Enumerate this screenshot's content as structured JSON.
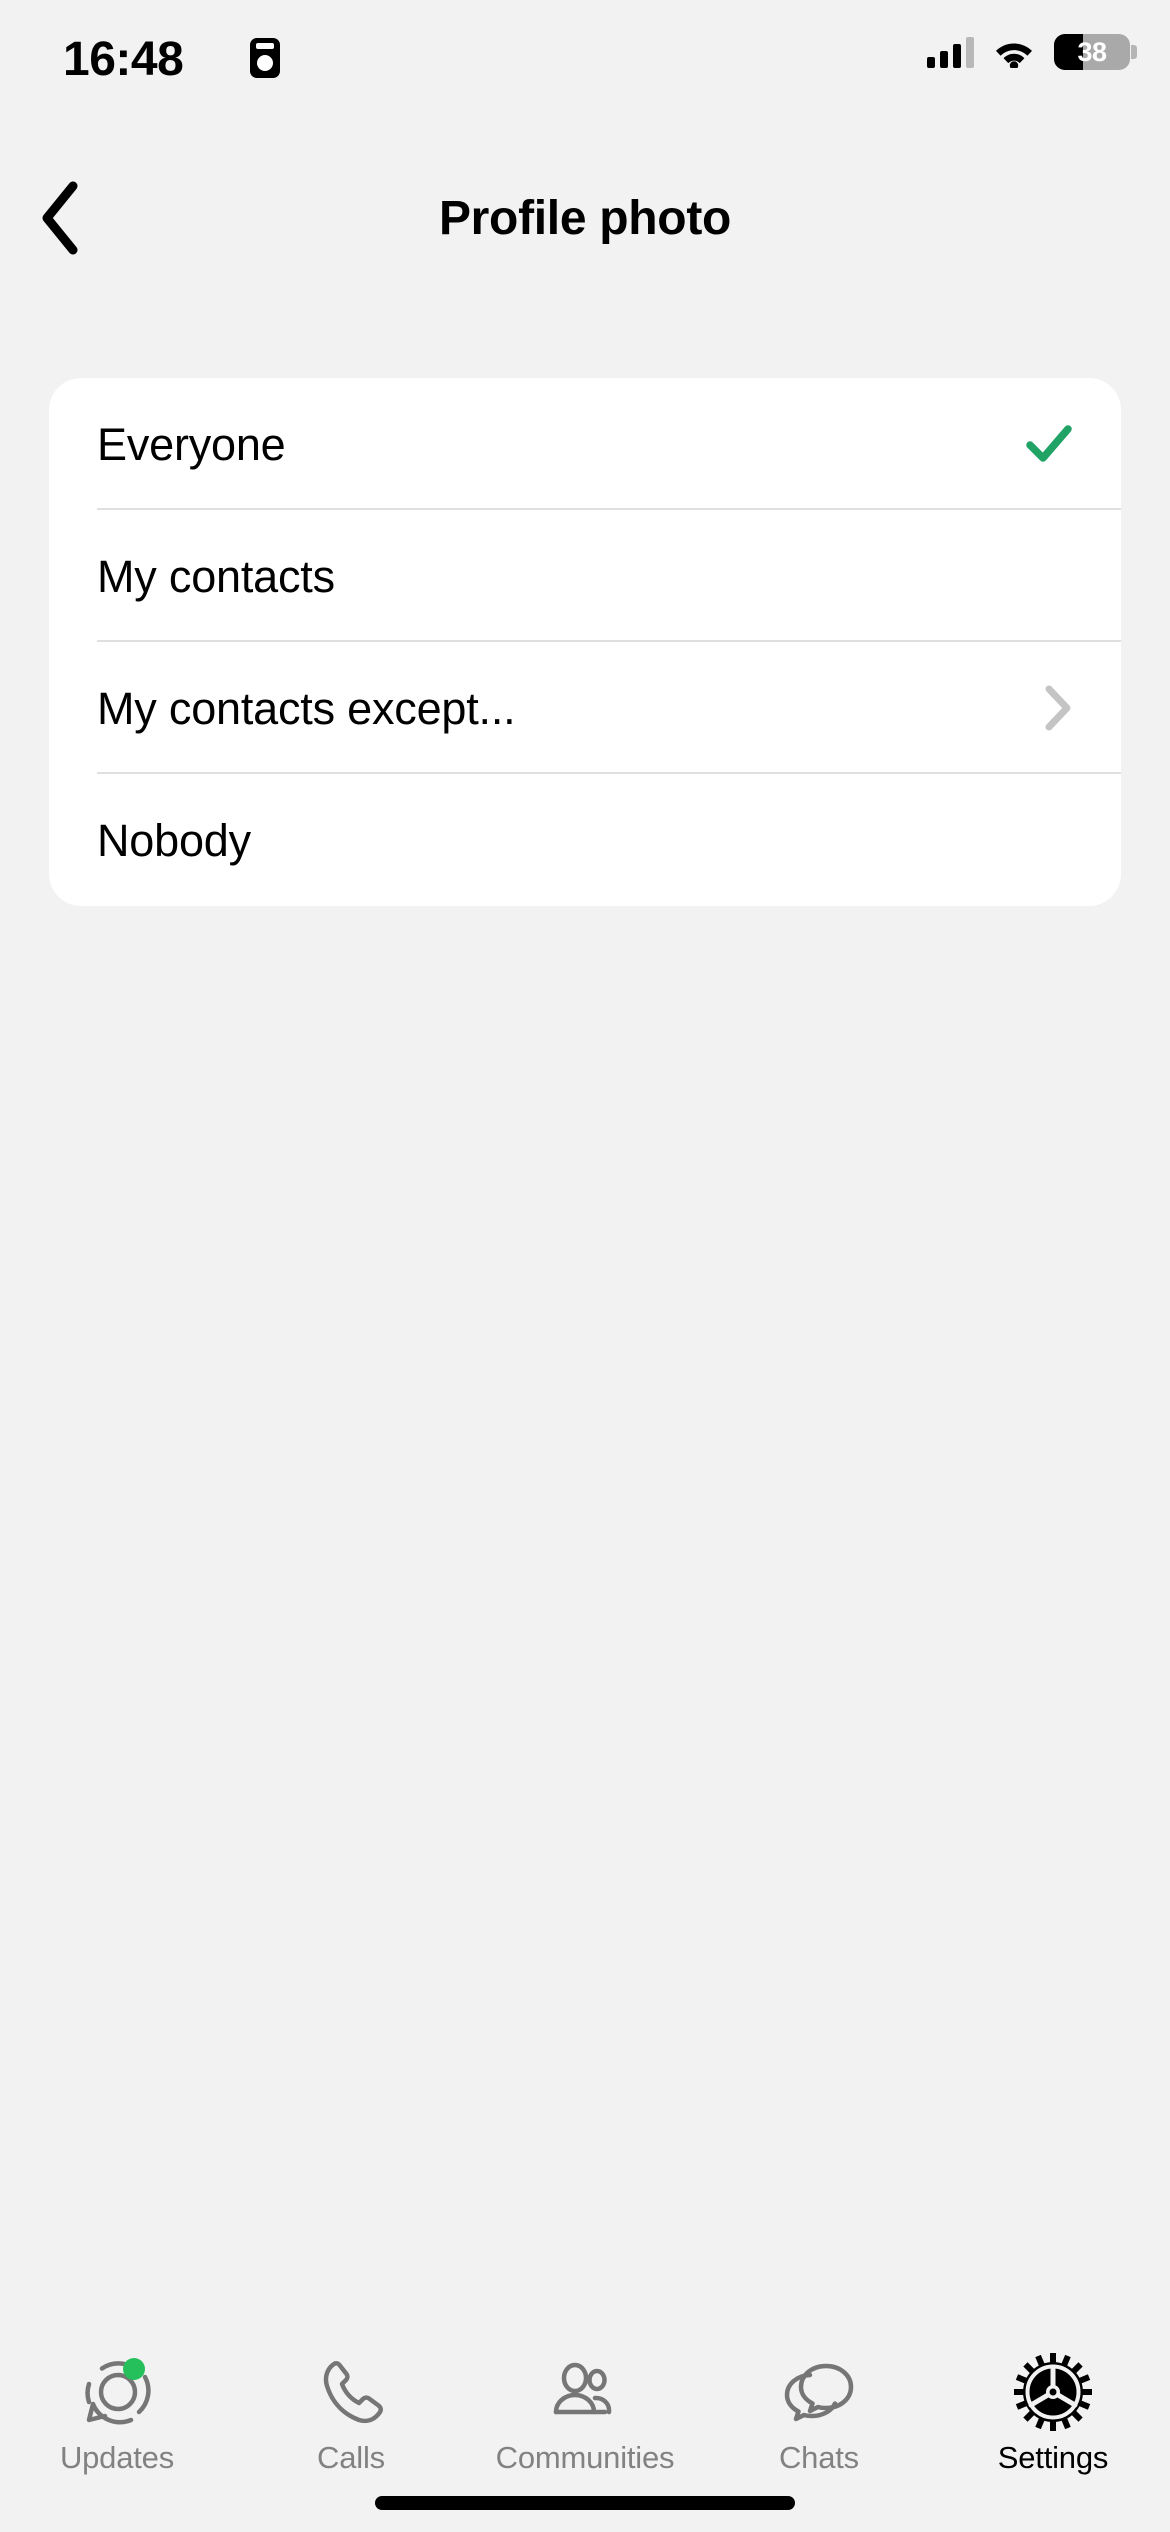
{
  "status_bar": {
    "time": "16:48",
    "recording_icon": "screen-record-icon",
    "signal_icon": "cellular-signal-icon",
    "signal_bars": 4,
    "signal_bars_active": 3,
    "wifi_icon": "wifi-icon",
    "battery_percent": "38",
    "battery_level": 38
  },
  "nav": {
    "back_icon": "chevron-left-icon",
    "title": "Profile photo"
  },
  "colors": {
    "background": "#f2f2f2",
    "card": "#ffffff",
    "check_green": "#21a366",
    "badge_green": "#25c05b",
    "divider": "#e0e0e0",
    "tab_inactive": "#828282",
    "tab_active": "#000000"
  },
  "options": [
    {
      "label": "Everyone",
      "selected": true,
      "checkmark": "check-icon",
      "disclosure": false
    },
    {
      "label": "My contacts",
      "selected": false,
      "checkmark": null,
      "disclosure": false
    },
    {
      "label": "My contacts except...",
      "selected": false,
      "checkmark": null,
      "disclosure": true
    },
    {
      "label": "Nobody",
      "selected": false,
      "checkmark": null,
      "disclosure": false
    }
  ],
  "tabs": [
    {
      "label": "Updates",
      "icon": "updates-icon",
      "active": false,
      "badge": true
    },
    {
      "label": "Calls",
      "icon": "calls-icon",
      "active": false,
      "badge": false
    },
    {
      "label": "Communities",
      "icon": "communities-icon",
      "active": false,
      "badge": false
    },
    {
      "label": "Chats",
      "icon": "chats-icon",
      "active": false,
      "badge": false
    },
    {
      "label": "Settings",
      "icon": "settings-gear-icon",
      "active": true,
      "badge": false
    }
  ]
}
